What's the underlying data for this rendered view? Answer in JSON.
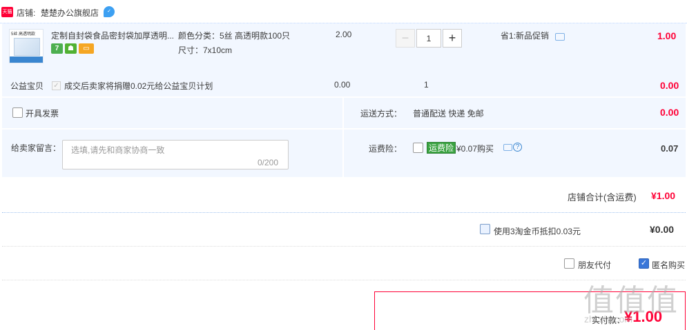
{
  "shop": {
    "badge": "天猫",
    "label": "店铺:",
    "name": "楚楚办公旗舰店"
  },
  "item": {
    "thumb_text": "5丝 高透明款",
    "title": "定制自封袋食品密封袋加厚透明...",
    "badge_7": "7",
    "sku_color": "颜色分类：5丝 高透明款100只",
    "sku_size": "尺寸：7x10cm",
    "price": "2.00",
    "quantity": "1",
    "promo": "省1:新品促销",
    "total": "1.00"
  },
  "charity": {
    "label": "公益宝贝",
    "desc": "成交后卖家将捐赠0.02元给公益宝贝计划",
    "price": "0.00",
    "qty": "1",
    "total": "0.00"
  },
  "invoice": {
    "label": "开具发票"
  },
  "shipping": {
    "label": "运送方式：",
    "value": "普通配送 快递 免邮",
    "total": "0.00"
  },
  "message": {
    "label": "给卖家留言：",
    "placeholder": "选填,请先和商家协商一致",
    "counter": "0/200"
  },
  "insurance": {
    "label": "运费险：",
    "tag": "运费险",
    "price": "¥0.07购买",
    "total": "0.07"
  },
  "shop_sum": {
    "label": "店铺合计(含运费)",
    "value": "¥1.00"
  },
  "coins": {
    "label": "使用3淘金币抵扣0.03元",
    "value": "¥0.00"
  },
  "options": {
    "friend_pay": "朋友代付",
    "anonymous": "匿名购买"
  },
  "payment": {
    "label": "实付款：",
    "value": "¥1.00"
  },
  "watermark": {
    "text": "值值值",
    "sub": "zhi.zhi.com"
  },
  "colors": {
    "accent_red": "#ff0036",
    "panel_bg": "#f2f7ff",
    "check_blue": "#3a77d9"
  }
}
